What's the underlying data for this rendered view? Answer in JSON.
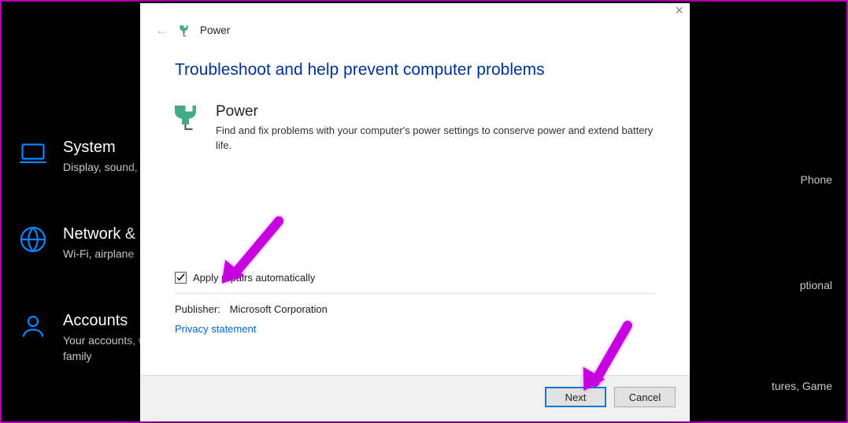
{
  "background": {
    "items": [
      {
        "title": "System",
        "subtitle": "Display, sound, power"
      },
      {
        "title": "Network & I",
        "subtitle": "Wi-Fi, airplane"
      },
      {
        "title": "Accounts",
        "subtitle": "Your accounts, work, family"
      }
    ],
    "right_fragments": [
      "Phone",
      "ptional",
      "tures, Game"
    ]
  },
  "dialog": {
    "header_title": "Power",
    "main_heading": "Troubleshoot and help prevent computer problems",
    "section": {
      "title": "Power",
      "description": "Find and fix problems with your computer's power settings to conserve power and extend battery life."
    },
    "checkbox": {
      "label": "Apply repairs automatically",
      "checked": true
    },
    "publisher": {
      "label": "Publisher:",
      "value": "Microsoft Corporation"
    },
    "privacy_link": "Privacy statement",
    "buttons": {
      "next": "Next",
      "cancel": "Cancel"
    }
  }
}
